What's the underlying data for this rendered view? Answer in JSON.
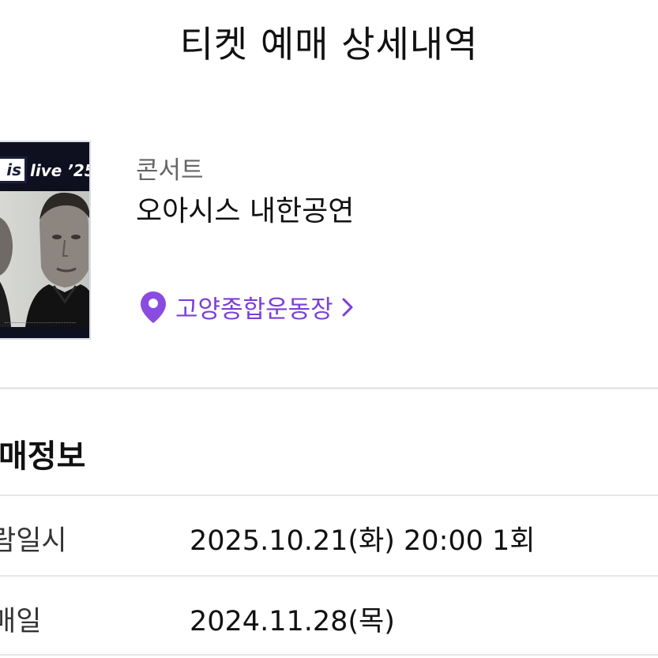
{
  "header": {
    "title": "티켓 예매 상세내역"
  },
  "event": {
    "poster": {
      "logo_text": "is",
      "tagline": "live ’25"
    },
    "category": "콘서트",
    "title": "오아시스 내한공연",
    "venue": "고양종합운동장",
    "venue_icon": "location-pin-icon",
    "venue_chevron_icon": "chevron-right-icon",
    "accent_color": "#7b3fd6"
  },
  "booking_info": {
    "section_title": "매정보",
    "rows": [
      {
        "label": "람일시",
        "value": "2025.10.21(화) 20:00 1회"
      },
      {
        "label": "매일",
        "value": "2024.11.28(목)"
      }
    ]
  }
}
